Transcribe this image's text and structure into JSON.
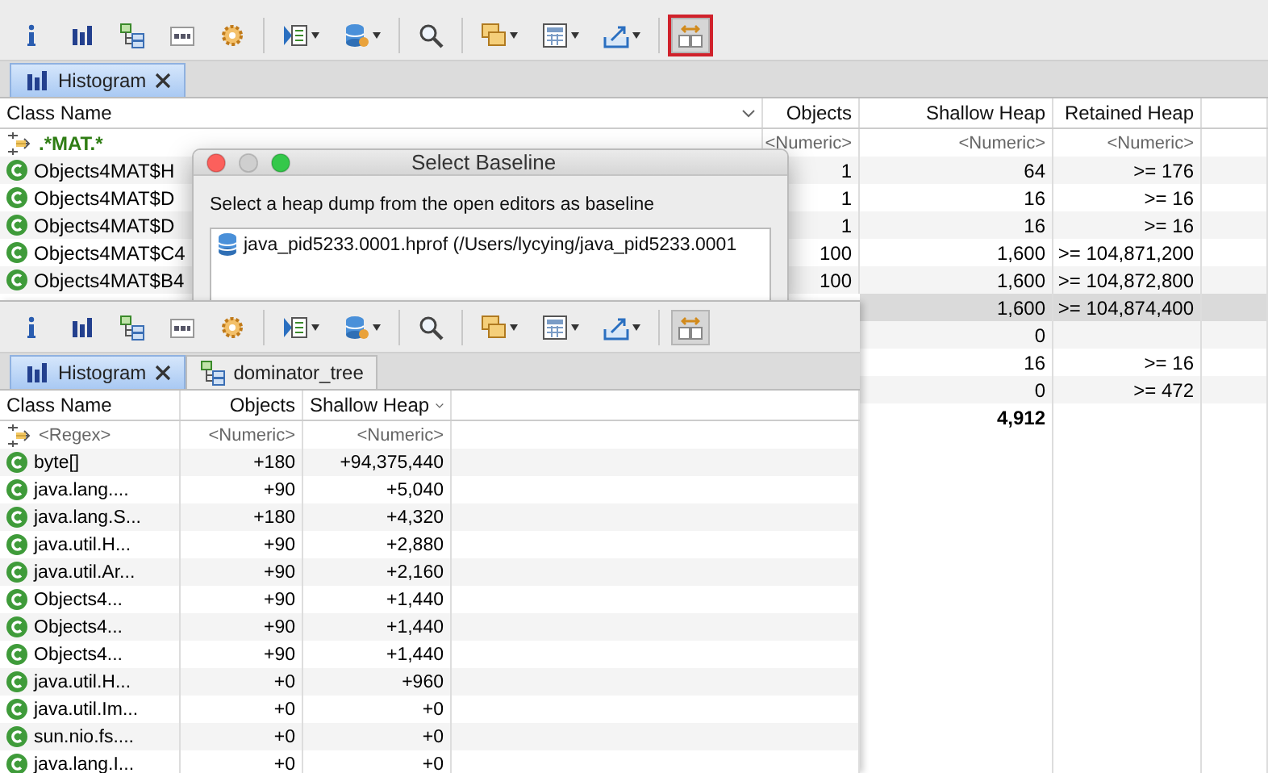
{
  "back_window": {
    "toolbar": [
      {
        "kind": "info"
      },
      {
        "kind": "histogram"
      },
      {
        "kind": "tree"
      },
      {
        "kind": "oql"
      },
      {
        "kind": "gear"
      },
      {
        "kind": "separator"
      },
      {
        "kind": "report",
        "dropdown": true
      },
      {
        "kind": "database",
        "dropdown": true
      },
      {
        "kind": "separator"
      },
      {
        "kind": "search"
      },
      {
        "kind": "separator"
      },
      {
        "kind": "windows",
        "dropdown": true
      },
      {
        "kind": "calculator",
        "dropdown": true
      },
      {
        "kind": "export",
        "dropdown": true
      },
      {
        "kind": "separator"
      },
      {
        "kind": "compare",
        "pressed": true,
        "highlighted": true
      }
    ],
    "tabs": [
      {
        "label": "Histogram",
        "kind": "histogram",
        "selected": true,
        "closable": true
      }
    ],
    "table": {
      "columns": [
        {
          "label": "Class Name",
          "sorted": true
        },
        {
          "label": "Objects",
          "sorted": false
        },
        {
          "label": "Shallow Heap",
          "sorted": false
        },
        {
          "label": "Retained Heap",
          "sorted": false
        }
      ],
      "filter": [
        {
          "value": ".*MAT.*"
        },
        {
          "placeholder": "<Numeric>"
        },
        {
          "placeholder": "<Numeric>"
        },
        {
          "placeholder": "<Numeric>"
        }
      ],
      "rows": [
        {
          "kind": "class",
          "selected": false,
          "cells": [
            "Objects4MAT$H",
            "1",
            "64",
            ">= 176"
          ]
        },
        {
          "kind": "class",
          "selected": false,
          "cells": [
            "Objects4MAT$D",
            "1",
            "16",
            ">= 16"
          ]
        },
        {
          "kind": "class",
          "selected": false,
          "cells": [
            "Objects4MAT$D",
            "1",
            "16",
            ">= 16"
          ]
        },
        {
          "kind": "class",
          "selected": false,
          "cells": [
            "Objects4MAT$C4",
            "100",
            "1,600",
            ">= 104,871,200"
          ]
        },
        {
          "kind": "class",
          "selected": false,
          "cells": [
            "Objects4MAT$B4",
            "100",
            "1,600",
            ">= 104,872,800"
          ]
        },
        {
          "kind": "class",
          "selected": true,
          "cells": [
            null,
            null,
            "1,600",
            ">= 104,874,400"
          ]
        },
        {
          "kind": "class",
          "selected": false,
          "cells": [
            null,
            null,
            "0",
            null
          ]
        },
        {
          "kind": "class",
          "selected": false,
          "cells": [
            null,
            null,
            "16",
            ">= 16"
          ]
        },
        {
          "kind": "class",
          "selected": false,
          "cells": [
            null,
            null,
            "0",
            ">= 472"
          ]
        },
        {
          "kind": "total",
          "selected": false,
          "cells": [
            null,
            null,
            "4,912",
            null
          ]
        }
      ]
    }
  },
  "dialog": {
    "title": "Select Baseline",
    "message": "Select a heap dump from the open editors as baseline",
    "items": [
      {
        "label": "java_pid5233.0001.hprof (/Users/lycying/java_pid5233.0001",
        "selected": false
      }
    ]
  },
  "front_window": {
    "toolbar": [
      {
        "kind": "info"
      },
      {
        "kind": "histogram"
      },
      {
        "kind": "tree"
      },
      {
        "kind": "oql"
      },
      {
        "kind": "gear"
      },
      {
        "kind": "separator"
      },
      {
        "kind": "report",
        "dropdown": true
      },
      {
        "kind": "database",
        "dropdown": true
      },
      {
        "kind": "separator"
      },
      {
        "kind": "search"
      },
      {
        "kind": "separator"
      },
      {
        "kind": "windows",
        "dropdown": true
      },
      {
        "kind": "calculator",
        "dropdown": true
      },
      {
        "kind": "export",
        "dropdown": true
      },
      {
        "kind": "separator"
      },
      {
        "kind": "compare",
        "pressed": true,
        "highlighted": false
      }
    ],
    "tabs": [
      {
        "label": "Histogram",
        "kind": "histogram",
        "selected": true,
        "closable": true
      },
      {
        "label": "dominator_tree",
        "kind": "tree",
        "selected": false,
        "closable": false
      }
    ],
    "table": {
      "columns": [
        {
          "label": "Class Name",
          "sorted": false
        },
        {
          "label": "Objects",
          "sorted": false
        },
        {
          "label": "Shallow Heap",
          "sorted": true
        }
      ],
      "filter": [
        {
          "placeholder": "<Regex>"
        },
        {
          "placeholder": "<Numeric>"
        },
        {
          "placeholder": "<Numeric>"
        }
      ],
      "rows": [
        {
          "kind": "class",
          "selected": false,
          "cells": [
            "byte[]",
            "+180",
            "+94,375,440"
          ]
        },
        {
          "kind": "class",
          "selected": false,
          "cells": [
            "java.lang....",
            "+90",
            "+5,040"
          ]
        },
        {
          "kind": "class",
          "selected": false,
          "cells": [
            "java.lang.S...",
            "+180",
            "+4,320"
          ]
        },
        {
          "kind": "class",
          "selected": false,
          "cells": [
            "java.util.H...",
            "+90",
            "+2,880"
          ]
        },
        {
          "kind": "class",
          "selected": false,
          "cells": [
            "java.util.Ar...",
            "+90",
            "+2,160"
          ]
        },
        {
          "kind": "class",
          "selected": false,
          "cells": [
            "Objects4...",
            "+90",
            "+1,440"
          ]
        },
        {
          "kind": "class",
          "selected": false,
          "cells": [
            "Objects4...",
            "+90",
            "+1,440"
          ]
        },
        {
          "kind": "class",
          "selected": false,
          "cells": [
            "Objects4...",
            "+90",
            "+1,440"
          ]
        },
        {
          "kind": "class",
          "selected": false,
          "cells": [
            "java.util.H...",
            "+0",
            "+960"
          ]
        },
        {
          "kind": "class",
          "selected": false,
          "cells": [
            "java.util.Im...",
            "+0",
            "+0"
          ]
        },
        {
          "kind": "class",
          "selected": false,
          "cells": [
            "sun.nio.fs....",
            "+0",
            "+0"
          ]
        },
        {
          "kind": "class",
          "selected": false,
          "cells": [
            "java.lang.I...",
            "+0",
            "+0"
          ]
        }
      ]
    }
  }
}
